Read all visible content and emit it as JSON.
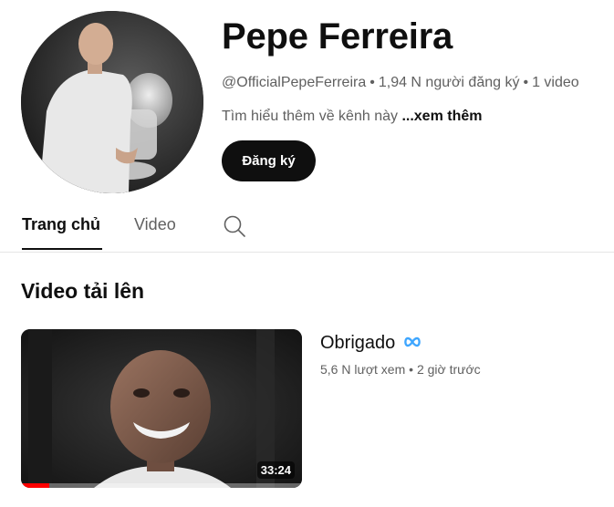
{
  "channel": {
    "name": "Pepe Ferreira",
    "handle": "@OfficialPepeFerreira",
    "subscribers": "1,94 N người đăng ký",
    "video_count": "1 video",
    "description": "Tìm hiểu thêm về kênh này",
    "more_label": "...xem thêm",
    "subscribe_label": "Đăng ký"
  },
  "tabs": [
    {
      "label": "Trang chủ",
      "active": true
    },
    {
      "label": "Video",
      "active": false
    }
  ],
  "section": {
    "title": "Video tải lên"
  },
  "video": {
    "title": "Obrigado",
    "views": "5,6 N lượt xem",
    "age": "2 giờ trước",
    "duration": "33:24",
    "watched_fraction": 0.1
  },
  "icons": {
    "search": "search-icon",
    "collab": "infinity-icon"
  },
  "colors": {
    "accent": "#ff0000",
    "link_icon": "#3ea6ff"
  }
}
